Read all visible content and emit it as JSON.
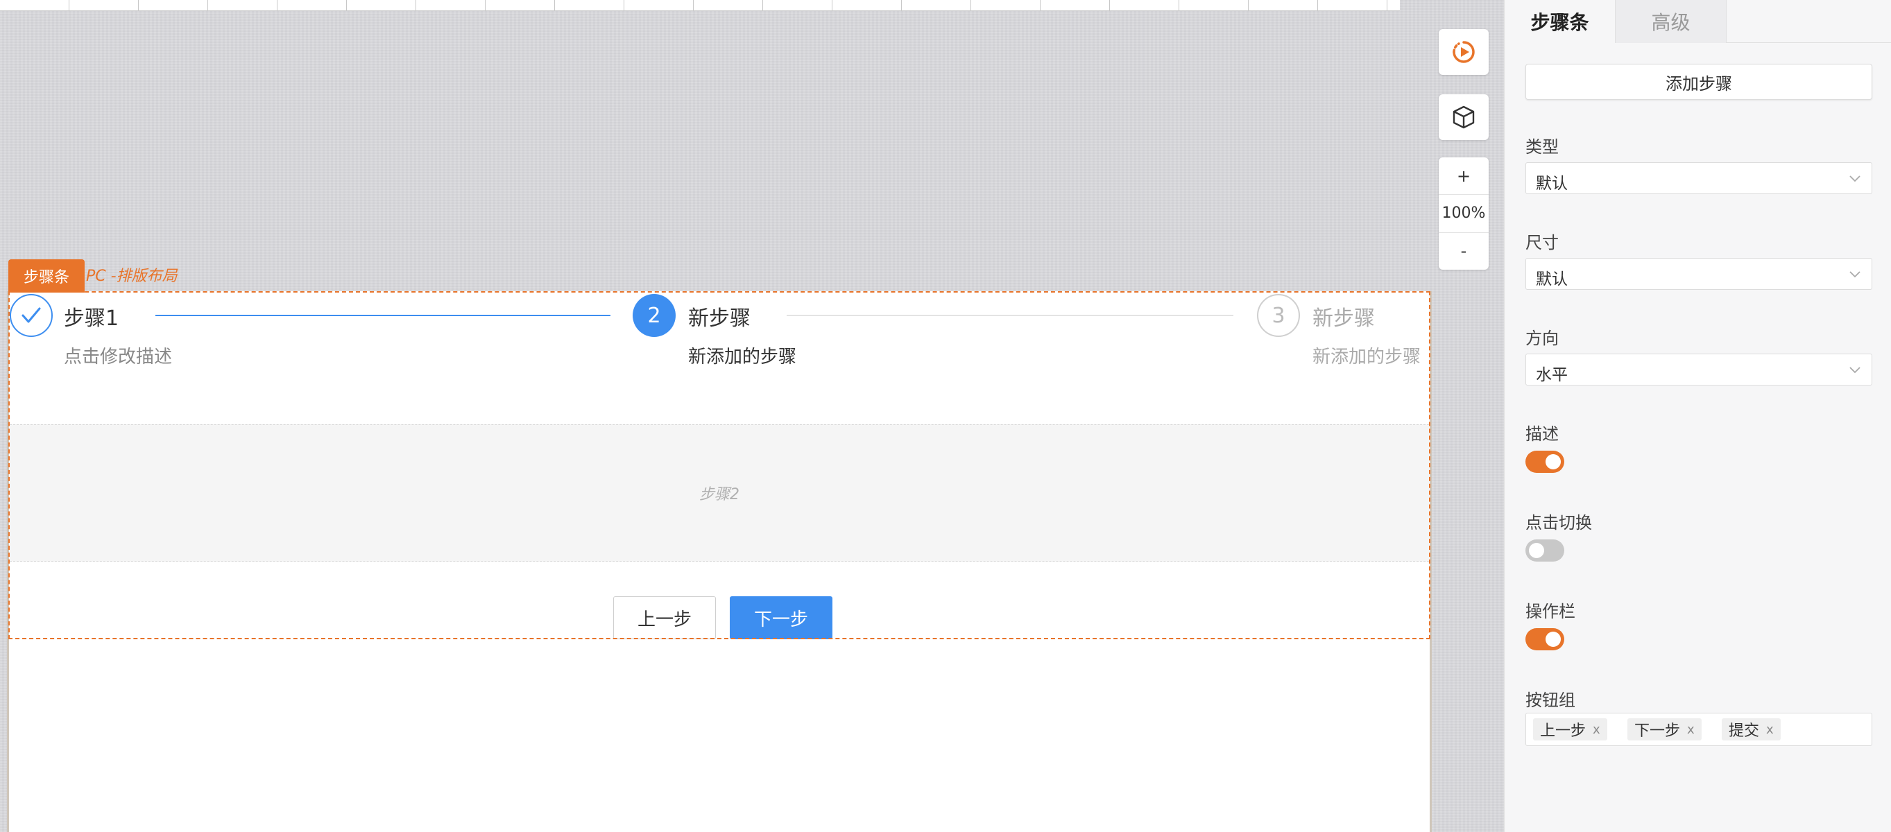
{
  "component": {
    "tag": "步骤条",
    "layout_label": "PC -排版布局"
  },
  "toolbar": {
    "zoom_in": "+",
    "zoom_level": "100%",
    "zoom_out": "-"
  },
  "steps": [
    {
      "number": "",
      "title": "步骤1",
      "description": "点击修改描述",
      "status": "finished"
    },
    {
      "number": "2",
      "title": "新步骤",
      "description": "新添加的步骤",
      "status": "active"
    },
    {
      "number": "3",
      "title": "新步骤",
      "description": "新添加的步骤",
      "status": "waiting"
    }
  ],
  "step_content": "步骤2",
  "actions": {
    "prev": "上一步",
    "next": "下一步"
  },
  "panel": {
    "tabs": [
      "步骤条",
      "高级"
    ],
    "add_step": "添加步骤",
    "type_label": "类型",
    "type_value": "默认",
    "size_label": "尺寸",
    "size_value": "默认",
    "direction_label": "方向",
    "direction_value": "水平",
    "description_label": "描述",
    "description_on": true,
    "click_switch_label": "点击切换",
    "click_switch_on": false,
    "action_bar_label": "操作栏",
    "action_bar_on": true,
    "button_group_label": "按钮组",
    "button_group": [
      "上一步",
      "下一步",
      "提交"
    ],
    "chip_remove": "x"
  },
  "colors": {
    "accent": "#e8742a",
    "primary": "#3d8ef0"
  }
}
